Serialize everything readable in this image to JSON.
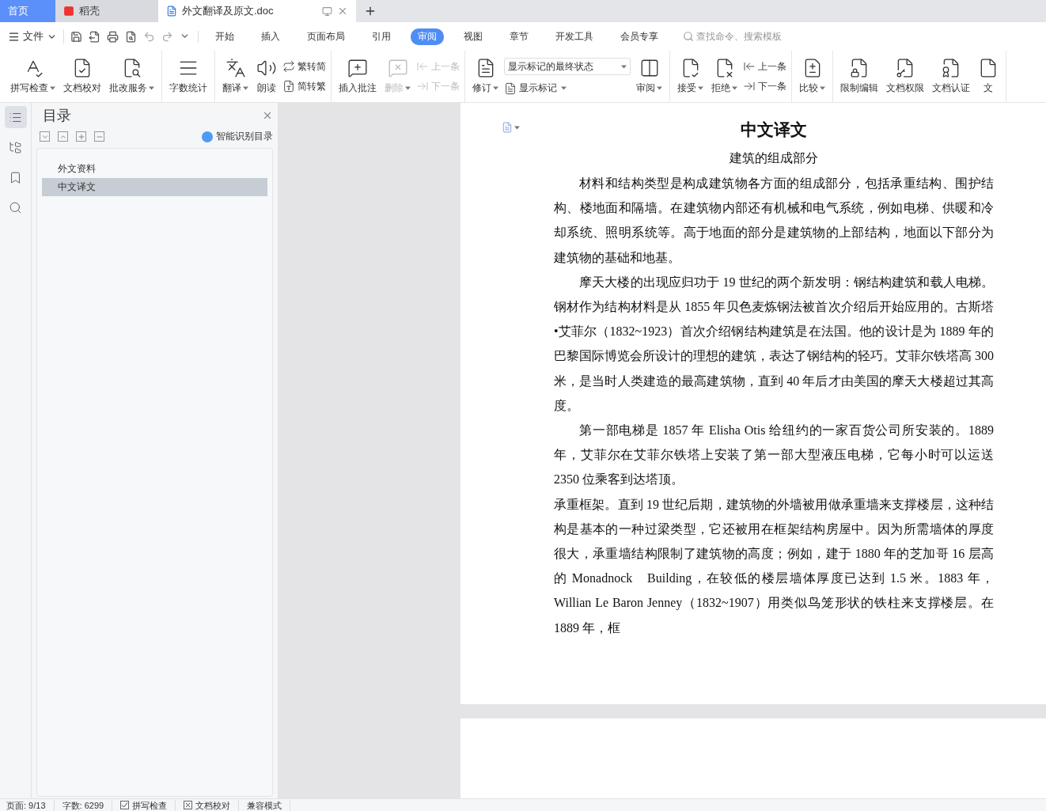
{
  "tabs": [
    {
      "kind": "home",
      "label": "首页",
      "selected": false
    },
    {
      "kind": "app",
      "label": "稻壳",
      "selected": false
    },
    {
      "kind": "doc",
      "label": "外文翻译及原文.doc",
      "selected": true
    }
  ],
  "menu": {
    "file": "文件",
    "tabs": [
      {
        "label": "开始",
        "selected": false
      },
      {
        "label": "插入",
        "selected": false
      },
      {
        "label": "页面布局",
        "selected": false
      },
      {
        "label": "引用",
        "selected": false
      },
      {
        "label": "审阅",
        "selected": true
      },
      {
        "label": "视图",
        "selected": false
      },
      {
        "label": "章节",
        "selected": false
      },
      {
        "label": "开发工具",
        "selected": false
      },
      {
        "label": "会员专享",
        "selected": false
      }
    ],
    "search": {
      "placeholder": "查找命令、搜索模板"
    }
  },
  "ribbon": [
    {
      "items": [
        {
          "kind": "large",
          "label": "拼写检查",
          "dropdown": true,
          "disabled": false
        },
        {
          "kind": "large",
          "label": "文档校对",
          "dropdown": false,
          "disabled": false
        },
        {
          "kind": "large",
          "label": "批改服务",
          "dropdown": true,
          "disabled": false
        }
      ]
    },
    {
      "items": [
        {
          "kind": "large",
          "label": "字数统计",
          "dropdown": false,
          "disabled": false
        }
      ]
    },
    {
      "items": [
        {
          "kind": "large",
          "label": "翻译",
          "dropdown": true,
          "disabled": false
        },
        {
          "kind": "large",
          "label": "朗读",
          "dropdown": false,
          "disabled": false
        },
        {
          "kind": "stack",
          "rows": [
            {
              "label": "繁转简",
              "disabled": false
            },
            {
              "label": "简转繁",
              "disabled": false
            }
          ]
        }
      ]
    },
    {
      "items": [
        {
          "kind": "large",
          "label": "插入批注",
          "dropdown": false,
          "disabled": false
        },
        {
          "kind": "large",
          "label": "删除",
          "dropdown": true,
          "disabled": true
        },
        {
          "kind": "stack",
          "rows": [
            {
              "label": "上一条",
              "disabled": true
            },
            {
              "label": "下一条",
              "disabled": true
            }
          ]
        }
      ]
    },
    {
      "items": [
        {
          "kind": "large",
          "label": "修订",
          "dropdown": true,
          "disabled": false
        },
        {
          "kind": "select",
          "value": "显示标记的最终状态",
          "button": "显示标记"
        },
        {
          "kind": "large",
          "label": "审阅",
          "dropdown": true,
          "disabled": false
        }
      ]
    },
    {
      "items": [
        {
          "kind": "large",
          "label": "接受",
          "dropdown": true,
          "disabled": false
        },
        {
          "kind": "large",
          "label": "拒绝",
          "dropdown": true,
          "disabled": false
        },
        {
          "kind": "stack",
          "rows": [
            {
              "label": "上一条",
              "disabled": false
            },
            {
              "label": "下一条",
              "disabled": false
            }
          ]
        }
      ]
    },
    {
      "items": [
        {
          "kind": "large",
          "label": "比较",
          "dropdown": true,
          "disabled": false
        }
      ]
    },
    {
      "items": [
        {
          "kind": "large",
          "label": "限制编辑",
          "dropdown": false,
          "disabled": false
        },
        {
          "kind": "large",
          "label": "文档权限",
          "dropdown": false,
          "disabled": false
        },
        {
          "kind": "large",
          "label": "文档认证",
          "dropdown": false,
          "disabled": false
        },
        {
          "kind": "large",
          "label": "文",
          "dropdown": false,
          "disabled": false
        }
      ]
    }
  ],
  "outline": {
    "title": "目录",
    "smart": "智能识别目录",
    "items": [
      {
        "label": "外文资料",
        "selected": false
      },
      {
        "label": "中文译文",
        "selected": true
      }
    ]
  },
  "document": {
    "title": "中文译文",
    "subtitle": "建筑的组成部分",
    "paragraphs": [
      {
        "kind": "indent",
        "text": "材料和结构类型是构成建筑物各方面的组成部分，包括承重结构、围护结构、楼地面和隔墙。在建筑物内部还有机械和电气系统，例如电梯、供暖和冷却系统、照明系统等。高于地面的部分是建筑物的上部结构，地面以下部分为建筑物的基础和地基。"
      },
      {
        "kind": "indent",
        "text": "摩天大楼的出现应归功于 19 世纪的两个新发明：钢结构建筑和载人电梯。钢材作为结构材料是从 1855 年贝色麦炼钢法被首次介绍后开始应用的。古斯塔•艾菲尔（1832~1923）首次介绍钢结构建筑是在法国。他的设计是为 1889 年的巴黎国际博览会所设计的理想的建筑，表达了钢结构的轻巧。艾菲尔铁塔高 300 米，是当时人类建造的最高建筑物，直到 40 年后才由美国的摩天大楼超过其高度。"
      },
      {
        "kind": "indent",
        "text": "第一部电梯是 1857 年 Elisha Otis 给纽约的一家百货公司所安装的。1889 年，艾菲尔在艾菲尔铁塔上安装了第一部大型液压电梯，它每小时可以运送 2350 位乘客到达塔顶。"
      },
      {
        "kind": "plain",
        "text": "承重框架。直到 19 世纪后期，建筑物的外墙被用做承重墙来支撑楼层，这种结构是基本的一种过梁类型，它还被用在框架结构房屋中。因为所需墙体的厚度很大，承重墙结构限制了建筑物的高度；例如，建于 1880 年的芝加哥 16 层高的 Monadnock　Building，在较低的楼层墙体厚度已达到 1.5 米。1883 年，Willian Le Baron Jenney（1832~1907）用类似鸟笼形状的铁柱来支撑楼层。在 1889 年，框"
      }
    ]
  },
  "status": [
    {
      "kind": "text",
      "label": "页面: 9/13"
    },
    {
      "kind": "text",
      "label": "字数: 6299"
    },
    {
      "kind": "check",
      "label": "拼写检查",
      "checked": true
    },
    {
      "kind": "cross",
      "label": "文档校对"
    },
    {
      "kind": "text",
      "label": "兼容模式"
    }
  ]
}
